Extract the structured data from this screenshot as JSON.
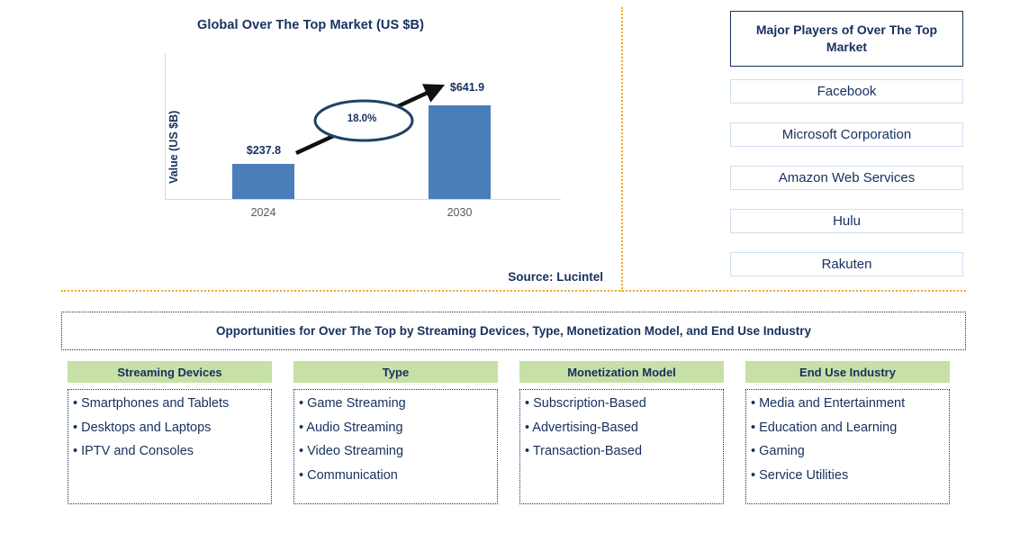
{
  "chart_data": {
    "type": "bar",
    "title": "Global Over The Top Market (US $B)",
    "ylabel": "Value (US $B)",
    "xlabel": "",
    "categories": [
      "2024",
      "2030"
    ],
    "values": [
      237.8,
      641.9
    ],
    "value_labels": [
      "$237.8",
      "$641.9"
    ],
    "cagr_label": "18.0%",
    "ylim": [
      0,
      700
    ],
    "grid": false,
    "legend": "none",
    "bar_color": "#4a7ebb",
    "annotation": "18.0% CAGR arrow from 2024 bar to 2030 bar"
  },
  "chart": {
    "title": "Global Over The Top Market (US $B)",
    "y_axis_label": "Value (US $B)",
    "bars": [
      {
        "category": "2024",
        "value_label": "$237.8"
      },
      {
        "category": "2030",
        "value_label": "$641.9"
      }
    ],
    "cagr": "18.0%",
    "source": "Source: Lucintel"
  },
  "players": {
    "header": "Major Players of Over The Top Market",
    "items": [
      {
        "label": "Facebook"
      },
      {
        "label": "Microsoft Corporation"
      },
      {
        "label": "Amazon Web Services"
      },
      {
        "label": "Hulu"
      },
      {
        "label": "Rakuten"
      }
    ]
  },
  "opportunities": {
    "title": "Opportunities for Over The Top by Streaming Devices, Type, Monetization Model, and End Use Industry",
    "columns": [
      {
        "header": "Streaming Devices",
        "items": [
          "• Smartphones and Tablets",
          "• Desktops and Laptops",
          "• IPTV and Consoles"
        ]
      },
      {
        "header": "Type",
        "items": [
          "• Game Streaming",
          "• Audio Streaming",
          "• Video Streaming",
          "• Communication"
        ]
      },
      {
        "header": "Monetization Model",
        "items": [
          "• Subscription-Based",
          "• Advertising-Based",
          "• Transaction-Based"
        ]
      },
      {
        "header": "End Use Industry",
        "items": [
          "• Media and Entertainment",
          "• Education and Learning",
          "• Gaming",
          "• Service Utilities"
        ]
      }
    ]
  },
  "colors": {
    "navy": "#17305e",
    "bar_blue": "#4a7ebb",
    "divider_orange": "#f5a623",
    "header_green": "#c6e0a5",
    "tick_gray": "#595959"
  }
}
